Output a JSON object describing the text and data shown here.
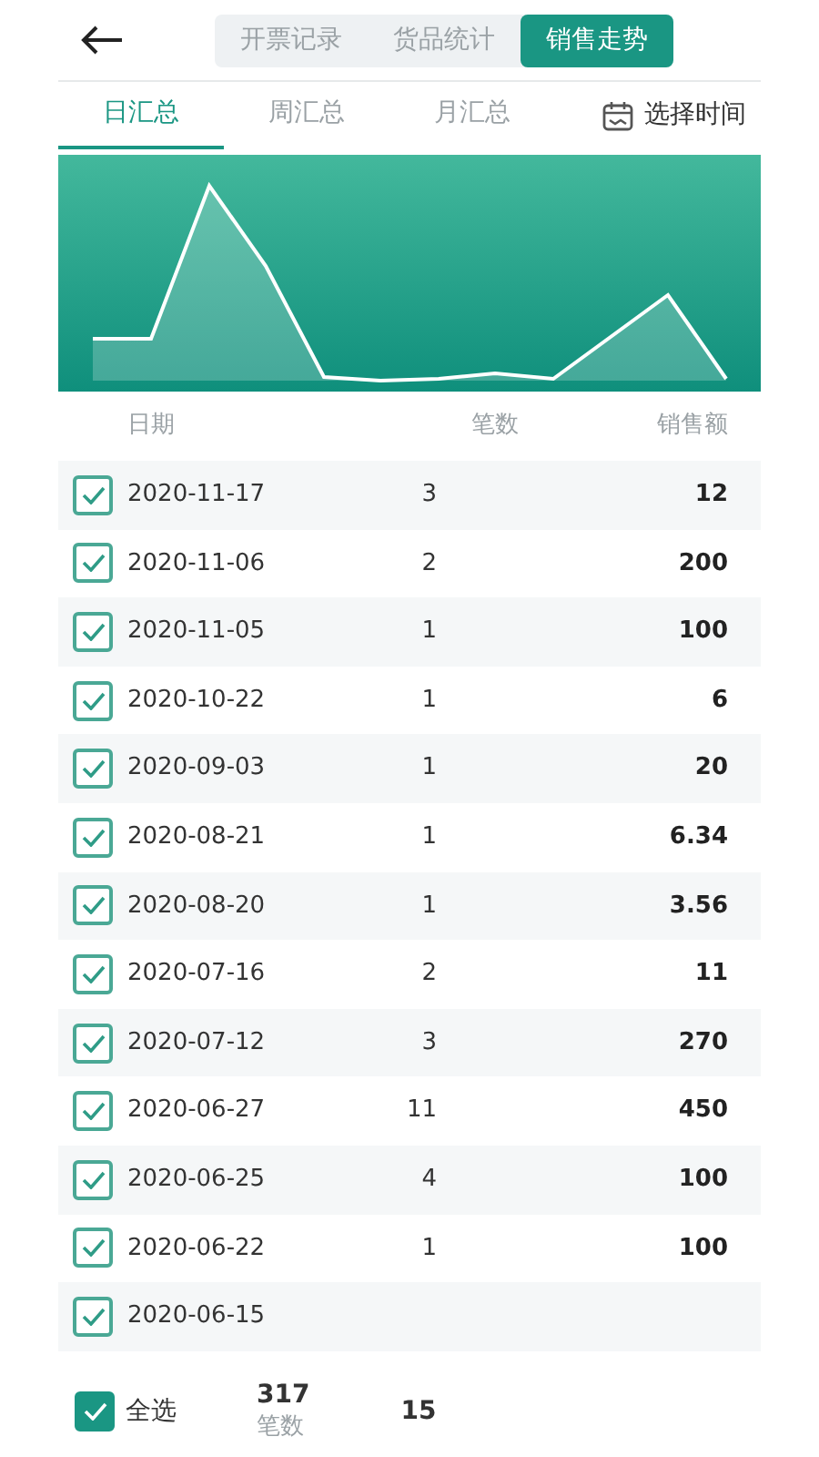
{
  "header": {
    "segments": [
      {
        "label": "开票记录",
        "selected": false
      },
      {
        "label": "货品统计",
        "selected": false
      },
      {
        "label": "销售走势",
        "selected": true
      }
    ]
  },
  "tabs": [
    {
      "label": "日汇总",
      "selected": true
    },
    {
      "label": "周汇总",
      "selected": false
    },
    {
      "label": "月汇总",
      "selected": false
    }
  ],
  "date_picker": {
    "label": "选择时间"
  },
  "table": {
    "columns": [
      "日期",
      "笔数",
      "销售额"
    ],
    "rows": [
      {
        "date": "2020-11-17",
        "count": "3",
        "amount": "12",
        "checked": true
      },
      {
        "date": "2020-11-06",
        "count": "2",
        "amount": "200",
        "checked": true
      },
      {
        "date": "2020-11-05",
        "count": "1",
        "amount": "100",
        "checked": true
      },
      {
        "date": "2020-10-22",
        "count": "1",
        "amount": "6",
        "checked": true
      },
      {
        "date": "2020-09-03",
        "count": "1",
        "amount": "20",
        "checked": true
      },
      {
        "date": "2020-08-21",
        "count": "1",
        "amount": "6.34",
        "checked": true
      },
      {
        "date": "2020-08-20",
        "count": "1",
        "amount": "3.56",
        "checked": true
      },
      {
        "date": "2020-07-16",
        "count": "2",
        "amount": "11",
        "checked": true
      },
      {
        "date": "2020-07-12",
        "count": "3",
        "amount": "270",
        "checked": true
      },
      {
        "date": "2020-06-27",
        "count": "11",
        "amount": "450",
        "checked": true
      },
      {
        "date": "2020-06-25",
        "count": "4",
        "amount": "100",
        "checked": true
      },
      {
        "date": "2020-06-22",
        "count": "1",
        "amount": "100",
        "checked": true
      },
      {
        "date": "2020-06-15",
        "checked": true
      }
    ]
  },
  "footer": {
    "select_all": {
      "label": "全选",
      "checked": true
    },
    "totals": [
      {
        "value": "317",
        "label": "笔数"
      },
      {
        "value": "15"
      }
    ]
  }
}
